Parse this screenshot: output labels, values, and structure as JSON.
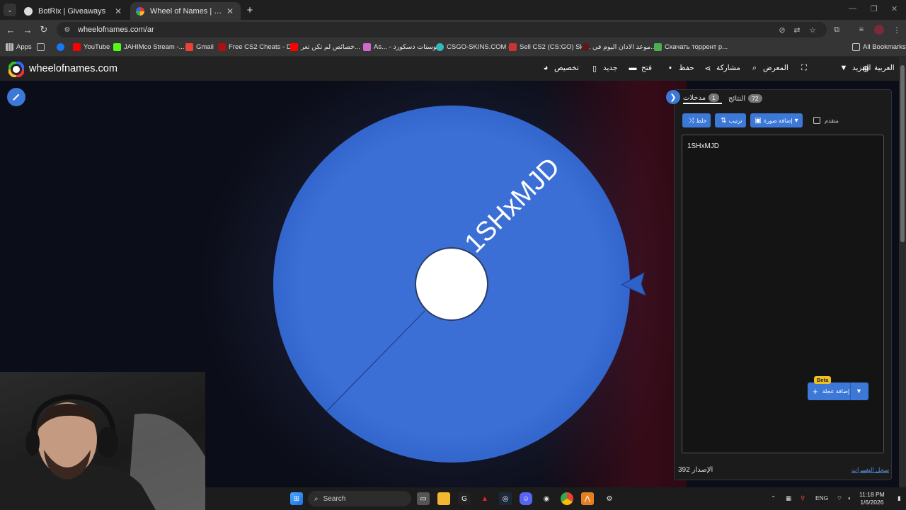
{
  "browser": {
    "tabs": [
      {
        "title": "BotRix | Giveaways",
        "active": false
      },
      {
        "title": "Wheel of Names | اسم العشوائي",
        "active": true
      }
    ],
    "url": "wheelofnames.com/ar",
    "bookmarks": [
      "Apps",
      "YouTube",
      "JAHIMco Stream -...",
      "Gmail",
      "Free CS2 Cheats - D...",
      "خصائص لم تكن تعر...",
      "As... - بوستات دسكورد",
      "CSGO-SKINS.COM -...",
      "Sell CS2 (CS:GO) Ski...",
      "موعد الاذان اليوم في...",
      "Скачать торрент р...",
      "All Bookmarks"
    ]
  },
  "site": {
    "name": "wheelofnames.com",
    "nav": {
      "language": "العربية",
      "more": "المزيد",
      "gallery": "المعرض",
      "share": "مشاركة",
      "save": "حفظ",
      "open": "فتح",
      "new": "جديد",
      "customize": "تخصيص"
    }
  },
  "wheel": {
    "entries": [
      "1SHxMJD"
    ],
    "colors": {
      "segment": "#3b6fd6",
      "center": "#ffffff",
      "pointer": "#2f62c9"
    }
  },
  "panel": {
    "tabs": {
      "entries_label": "مدخلات",
      "entries_count": "1",
      "results_label": "النتائج",
      "results_count": "72"
    },
    "buttons": {
      "shuffle": "خلط",
      "sort": "ترتيب",
      "add_image": "إضافة صورة",
      "advanced": "متقدم"
    },
    "entries_text": "1SHxMJD",
    "add_wheel": "إضافة عجلة",
    "beta": "Beta",
    "version_label": "الإصدار",
    "version_number": "392",
    "changelog": "سجل التغييرات"
  },
  "taskbar": {
    "search_placeholder": "Search",
    "language": "ENG",
    "time": "11:18 PM",
    "date": "1/6/2026"
  },
  "theme": {
    "accent": "#3b78d8",
    "header_bg": "#222222"
  }
}
